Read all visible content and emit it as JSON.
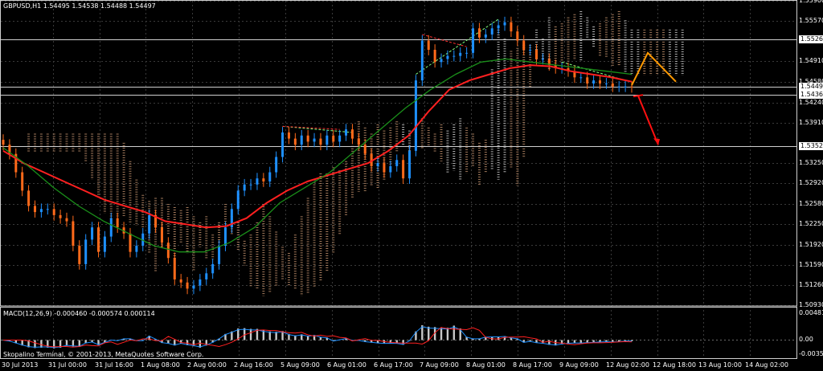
{
  "window": {
    "header": "GBPUSD,H1  1.54495 1.54538 1.54488 1.54497",
    "copyright": "Skopalino Terminal, © 2001-2013, MetaQuotes Software Corp."
  },
  "macd": {
    "header": "MACD(12,26,9) -0.000460 -0.000574 0.000114",
    "axis_labels": [
      "0.004812",
      "0.00",
      "-0.00356"
    ]
  },
  "price_axis": {
    "labels": [
      "1.55900",
      "1.55570",
      "1.55268",
      "1.54910",
      "1.54580",
      "1.54497",
      "1.54364",
      "1.54240",
      "1.53910",
      "1.53527",
      "1.53250",
      "1.52920",
      "1.52580",
      "1.52250",
      "1.51920",
      "1.51590",
      "1.51260",
      "1.50930"
    ],
    "highlight_levels": [
      {
        "label": "1.55268",
        "value": 1.55268
      },
      {
        "label": "1.54497",
        "value": 1.54497
      },
      {
        "label": "1.54364",
        "value": 1.54364
      },
      {
        "label": "1.53527",
        "value": 1.53527
      }
    ]
  },
  "time_axis": {
    "labels": [
      "30 Jul 2013",
      "31 Jul 00:00",
      "31 Jul 16:00",
      "1 Aug 08:00",
      "2 Aug 00:00",
      "2 Aug 16:00",
      "5 Aug 09:00",
      "6 Aug 01:00",
      "6 Aug 17:00",
      "7 Aug 09:00",
      "8 Aug 01:00",
      "8 Aug 17:00",
      "9 Aug 09:00",
      "12 Aug 02:00",
      "12 Aug 18:00",
      "13 Aug 10:00",
      "14 Aug 02:00"
    ]
  },
  "colors": {
    "background": "#000000",
    "grid": "#3a3a3a",
    "bull": "#1e90ff",
    "bear": "#ff6a1a",
    "ma_fast": "#ff2020",
    "ma_slow": "#1a8f1a",
    "cloud": "#d8a27a",
    "cloud_alt": "#e8e8e8",
    "macd_hist": "#c8c8c8",
    "macd_line": "#1e90ff",
    "signal_line": "#ff2020",
    "forecast_up": "#ff9900",
    "forecast_down": "#ff1010"
  },
  "chart_data": {
    "type": "candlestick",
    "symbol": "GBPUSD",
    "timeframe": "H1",
    "ylim": [
      1.5093,
      1.559
    ],
    "series": [
      {
        "name": "GBPUSD,H1",
        "close": [
          1.5355,
          1.534,
          1.531,
          1.528,
          1.5255,
          1.5245,
          1.525,
          1.525,
          1.524,
          1.5235,
          1.523,
          1.519,
          1.516,
          1.52,
          1.522,
          1.518,
          1.5205,
          1.5235,
          1.522,
          1.521,
          1.518,
          1.519,
          1.521,
          1.524,
          1.522,
          1.5195,
          1.517,
          1.5135,
          1.513,
          1.512,
          1.5125,
          1.5135,
          1.5145,
          1.516,
          1.519,
          1.522,
          1.525,
          1.528,
          1.529,
          1.529,
          1.53,
          1.5295,
          1.531,
          1.5335,
          1.5375,
          1.5365,
          1.5355,
          1.537,
          1.536,
          1.5365,
          1.5355,
          1.537,
          1.536,
          1.537,
          1.538,
          1.5365,
          1.5355,
          1.534,
          1.532,
          1.5325,
          1.531,
          1.532,
          1.533,
          1.53,
          1.5345,
          1.546,
          1.5525,
          1.551,
          1.549,
          1.5495,
          1.55,
          1.55,
          1.5505,
          1.5505,
          1.5545,
          1.553,
          1.5535,
          1.5545,
          1.555,
          1.5555,
          1.554,
          1.5525,
          1.551,
          1.551,
          1.5495,
          1.5495,
          1.5485,
          1.548,
          1.548,
          1.5475,
          1.5465,
          1.5465,
          1.5455,
          1.546,
          1.5455,
          1.5455,
          1.545,
          1.545,
          1.545,
          1.5449
        ]
      },
      {
        "name": "MA fast",
        "values": [
          1.5345,
          1.5325,
          1.531,
          1.5295,
          1.528,
          1.5265,
          1.5255,
          1.5245,
          1.523,
          1.5225,
          1.522,
          1.5222,
          1.5235,
          1.526,
          1.528,
          1.5295,
          1.5305,
          1.5315,
          1.5325,
          1.5345,
          1.537,
          1.541,
          1.5445,
          1.546,
          1.547,
          1.548,
          1.5485,
          1.5483,
          1.5475,
          1.547,
          1.5465,
          1.5458
        ]
      },
      {
        "name": "MA slow",
        "values": [
          1.535,
          1.532,
          1.5285,
          1.5255,
          1.523,
          1.521,
          1.519,
          1.518,
          1.518,
          1.5195,
          1.522,
          1.526,
          1.5285,
          1.531,
          1.5345,
          1.538,
          1.5415,
          1.5445,
          1.547,
          1.549,
          1.5495,
          1.549,
          1.5485,
          1.548,
          1.5475,
          1.547
        ]
      }
    ],
    "forecast": {
      "up_path": [
        1.5452,
        1.5505,
        1.5458
      ],
      "down_path": [
        1.5435,
        1.5355
      ]
    }
  }
}
